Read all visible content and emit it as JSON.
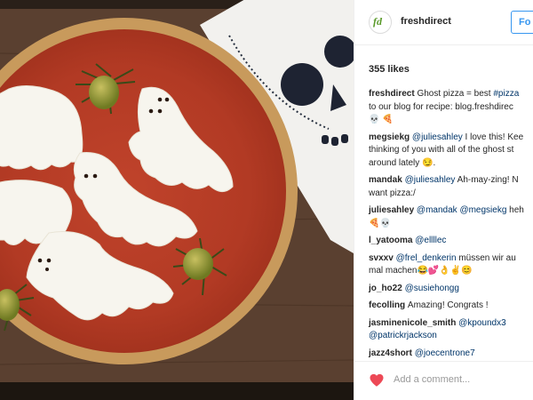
{
  "post": {
    "username": "freshdirect",
    "avatar_text": "fd",
    "follow_label": "Fo",
    "likes": "355 likes"
  },
  "comments": [
    {
      "user": "freshdirect",
      "parts": [
        {
          "t": "Ghost pizza = best "
        },
        {
          "t": "#pizza",
          "m": true
        }
      ],
      "parts2": [
        {
          "t": "to our blog for recipe: blog.freshdirec"
        }
      ],
      "emoji": "💀 🍕"
    },
    {
      "user": "megsiekg",
      "parts": [
        {
          "t": "@juliesahley",
          "m": true
        },
        {
          "t": " I love this! Kee"
        }
      ],
      "parts2": [
        {
          "t": "thinking of you with all of the ghost st"
        }
      ],
      "parts3": [
        {
          "t": "around lately 😏."
        }
      ]
    },
    {
      "user": "mandak",
      "parts": [
        {
          "t": "@juliesahley",
          "m": true
        },
        {
          "t": " Ah-may-zing! N"
        }
      ],
      "parts2": [
        {
          "t": "want pizza:/"
        }
      ]
    },
    {
      "user": "juliesahley",
      "parts": [
        {
          "t": "@mandak",
          "m": true
        },
        {
          "t": " "
        },
        {
          "t": "@megsiekg",
          "m": true
        },
        {
          "t": " heh"
        }
      ],
      "emoji": "🍕💀"
    },
    {
      "user": "l_yatooma",
      "parts": [
        {
          "t": "@ellllec",
          "m": true
        }
      ]
    },
    {
      "user": "svxxv",
      "parts": [
        {
          "t": "@frel_denkerin",
          "m": true
        },
        {
          "t": " müssen wir au"
        }
      ],
      "parts2": [
        {
          "t": "mal machen😂💕👌✌️😊"
        }
      ]
    },
    {
      "user": "jo_ho22",
      "parts": [
        {
          "t": "@susiehongg",
          "m": true
        }
      ]
    },
    {
      "user": "fecolling",
      "parts": [
        {
          "t": "Amazing! Congrats !"
        }
      ]
    },
    {
      "user": "jasminenicole_smith",
      "parts": [
        {
          "t": "@kpoundx3",
          "m": true
        }
      ],
      "parts2": [
        {
          "t": "@patrickrjackson",
          "m": true
        }
      ]
    },
    {
      "user": "jazz4short",
      "parts": [
        {
          "t": "@joecentrone7",
          "m": true
        }
      ]
    }
  ],
  "footer": {
    "add_comment_placeholder": "Add a comment..."
  },
  "colors": {
    "accent": "#3897f0",
    "mention": "#003569",
    "heart": "#ed4956"
  },
  "icons": {
    "like": "heart-icon",
    "avatar": "freshdirect-logo-icon"
  }
}
